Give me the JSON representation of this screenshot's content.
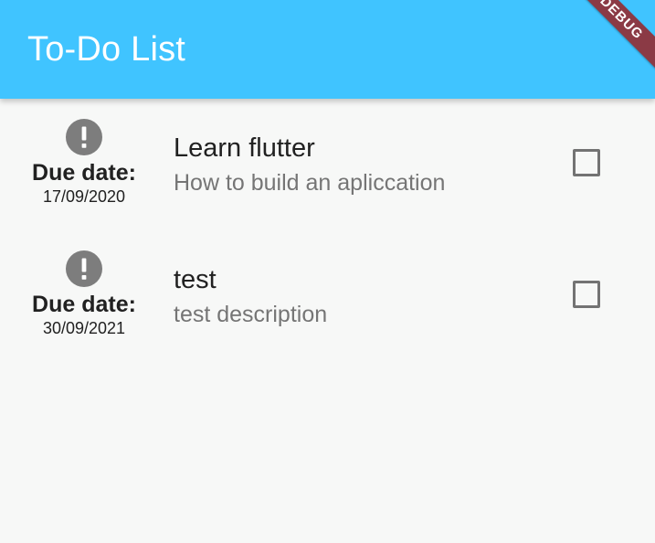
{
  "app_bar": {
    "title": "To-Do List",
    "color": "#40c4ff",
    "debug_banner": "DEBUG"
  },
  "todos": [
    {
      "icon": "exclamation-circle-icon",
      "due_label": "Due date:",
      "due_date": "17/09/2020",
      "title": "Learn flutter",
      "description": "How to build an apliccation",
      "checked": false
    },
    {
      "icon": "exclamation-circle-icon",
      "due_label": "Due date:",
      "due_date": "30/09/2021",
      "title": "test",
      "description": "test description",
      "checked": false
    }
  ]
}
